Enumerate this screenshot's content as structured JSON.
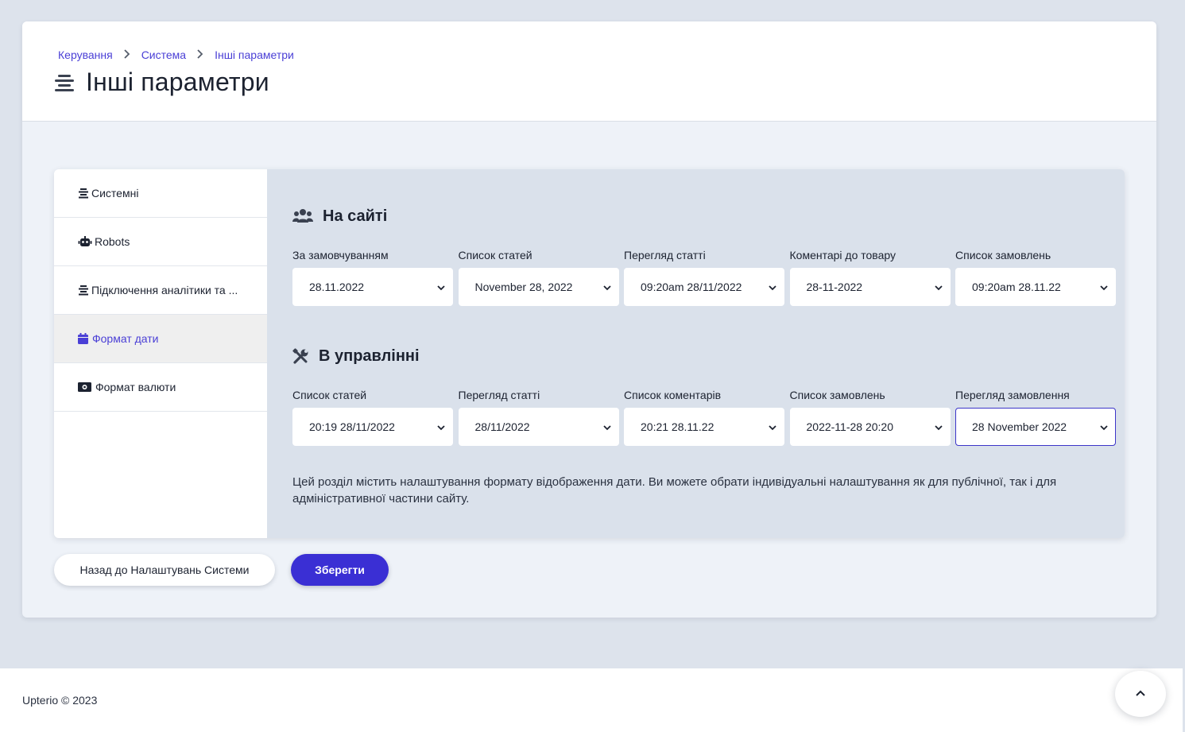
{
  "breadcrumb": [
    "Керування",
    "Система",
    "Інші параметри"
  ],
  "page": {
    "title": "Інші параметри"
  },
  "sidebar": {
    "items": [
      {
        "label": "Системні",
        "icon": "list-icon"
      },
      {
        "label": "Robots",
        "icon": "robot-icon"
      },
      {
        "label": "Підключення аналітики та ...",
        "icon": "list-icon"
      },
      {
        "label": "Формат дати",
        "icon": "calendar-icon",
        "active": true
      },
      {
        "label": "Формат валюти",
        "icon": "money-icon"
      }
    ]
  },
  "site": {
    "title": "На сайті",
    "icon": "users-icon",
    "fields": [
      {
        "label": "За замовчуванням",
        "value": "28.11.2022"
      },
      {
        "label": "Список статей",
        "value": "November 28, 2022"
      },
      {
        "label": "Перегляд статті",
        "value": "09:20am 28/11/2022"
      },
      {
        "label": "Коментарі до товару",
        "value": "28-11-2022"
      },
      {
        "label": "Список замовлень",
        "value": "09:20am 28.11.22"
      }
    ]
  },
  "admin": {
    "title": "В управлінні",
    "icon": "tools-icon",
    "fields": [
      {
        "label": "Список статей",
        "value": "20:19 28/11/2022"
      },
      {
        "label": "Перегляд статті",
        "value": "28/11/2022"
      },
      {
        "label": "Список коментарів",
        "value": "20:21 28.11.22"
      },
      {
        "label": "Список замовлень",
        "value": "2022-11-28 20:20"
      },
      {
        "label": "Перегляд замовлення",
        "value": "28 November 2022"
      }
    ]
  },
  "description": "Цей розділ містить налаштування формату відображення дати. Ви можете обрати індивідуальні налаштування як для публічної, так і для адміністративної частини сайту.",
  "buttons": {
    "back": "Назад до Налаштувань Системи",
    "save": "Зберегти"
  },
  "footer": {
    "copyright": "Upterio © 2023"
  },
  "colors": {
    "accent": "#3a2fd4",
    "link": "#4a3fd6",
    "panel": "#dae1eb",
    "background": "#dde3ec"
  }
}
